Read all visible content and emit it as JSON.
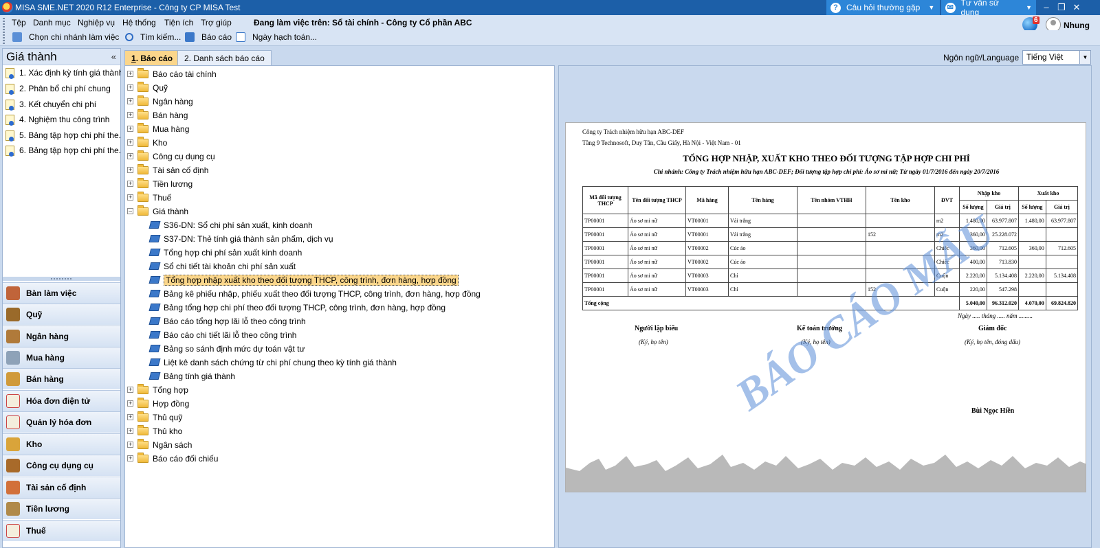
{
  "window": {
    "title": "MISA SME.NET 2020 R12 Enterprise - Công ty CP MISA Test",
    "faq": "Câu hỏi thường gặp",
    "support": "Tư vấn sử dụng"
  },
  "menu": {
    "items": [
      "Tệp",
      "Danh mục",
      "Nghiệp vụ",
      "Hệ thống",
      "Tiện ích",
      "Trợ giúp"
    ],
    "working_on": "Đang làm việc trên: Sổ tài chính - Công ty Cổ phần ABC",
    "notification_count": "6",
    "user": "Nhung"
  },
  "toolbar": {
    "branch": "Chọn chi nhánh làm việc",
    "search": "Tìm kiếm...",
    "report": "Báo cáo",
    "posting_date": "Ngày hạch toán..."
  },
  "left_panel": {
    "title": "Giá thành",
    "items": [
      "1. Xác định kỳ tính giá thành",
      "2. Phân bổ chi phí chung",
      "3. Kết chuyển chi phí",
      "4. Nghiệm thu công trình",
      "5. Bảng tập hợp chi phí the...",
      "6. Bảng tập hợp chi phí the..."
    ],
    "nav": [
      "Bàn làm việc",
      "Quỹ",
      "Ngân hàng",
      "Mua hàng",
      "Bán hàng",
      "Hóa đơn điện tử",
      "Quản lý hóa đơn",
      "Kho",
      "Công cụ dụng cụ",
      "Tài sản cố định",
      "Tiền lương",
      "Thuế"
    ]
  },
  "tabs": {
    "reports_num": "1",
    "reports_text": ". Báo cáo",
    "report_list": "2. Danh sách báo cáo"
  },
  "language": {
    "label": "Ngôn ngữ/Language",
    "value": "Tiếng Việt"
  },
  "tree": {
    "folders_before": [
      "Báo cáo tài chính",
      "Quỹ",
      "Ngân hàng",
      "Bán hàng",
      "Mua hàng",
      "Kho",
      "Công cụ dụng cụ",
      "Tài sản cố định",
      "Tiền lương",
      "Thuế"
    ],
    "expanded_folder": "Giá thành",
    "reports": [
      "S36-DN: Sổ chi phí sản xuất, kinh doanh",
      "S37-DN: Thẻ tính giá thành sản phẩm, dịch vụ",
      "Tổng hợp chi phí sản xuất kinh doanh",
      "Sổ chi tiết tài khoản chi phí sản xuất",
      "Tổng hợp nhập xuất kho theo đối tượng THCP, công trình, đơn hàng, hợp đồng",
      "Bảng kê phiếu nhập, phiếu xuất theo đối tượng THCP, công trình, đơn hàng, hợp đồng",
      "Bảng tổng hợp chi phí theo đối tượng THCP, công trình, đơn hàng, hợp đồng",
      "Báo cáo tổng hợp lãi lỗ theo công trình",
      "Báo cáo chi tiết lãi lỗ theo công trình",
      "Bảng so sánh định mức dự toán vật tư",
      "Liệt kê danh sách chứng từ chi phí chung theo kỳ tính giá thành",
      "Bảng tính giá thành"
    ],
    "selected_index": 4,
    "folders_after": [
      "Tổng hợp",
      "Hợp đồng",
      "Thủ quỹ",
      "Thủ kho",
      "Ngân sách",
      "Báo cáo đối chiếu"
    ]
  },
  "report_preview": {
    "company": "Công ty Trách nhiệm hữu hạn ABC-DEF",
    "address": "Tầng 9 Technosoft, Duy Tân, Cầu Giấy, Hà Nội - Việt Nam - 01",
    "title": "TỔNG HỢP NHẬP, XUẤT KHO THEO ĐỐI TƯỢNG TẬP HỢP CHI PHÍ",
    "subtitle": "Chi nhánh: Công ty Trách nhiệm hữu hạn ABC-DEF; Đối tượng tập hợp chi phí: Áo sơ mi nữ; Từ ngày 01/7/2016 đến ngày 20/7/2016",
    "headers": [
      "Mã đối tượng THCP",
      "Tên đối tượng THCP",
      "Mã hàng",
      "Tên hàng",
      "Tên nhóm VTHH",
      "Tên kho",
      "ĐVT",
      "Nhập kho",
      "Xuất kho"
    ],
    "subheaders": [
      "Số lượng",
      "Giá trị",
      "Số lượng",
      "Giá trị"
    ],
    "rows": [
      [
        "TP00001",
        "Áo sơ mi nữ",
        "VT00001",
        "Vải trắng",
        "",
        "",
        "m2",
        "1.480,00",
        "63.977.807",
        "1.480,00",
        "63.977.807"
      ],
      [
        "TP00001",
        "Áo sơ mi nữ",
        "VT00001",
        "Vải trắng",
        "",
        "152",
        "m2",
        "360,00",
        "25.228.072",
        "",
        ""
      ],
      [
        "TP00001",
        "Áo sơ mi nữ",
        "VT00002",
        "Cúc áo",
        "",
        "",
        "Chiếc",
        "360,00",
        "712.605",
        "360,00",
        "712.605"
      ],
      [
        "TP00001",
        "Áo sơ mi nữ",
        "VT00002",
        "Cúc áo",
        "",
        "",
        "Chiếc",
        "400,00",
        "713.830",
        "",
        ""
      ],
      [
        "TP00001",
        "Áo sơ mi nữ",
        "VT00003",
        "Chỉ",
        "",
        "",
        "Cuộn",
        "2.220,00",
        "5.134.408",
        "2.220,00",
        "5.134.408"
      ],
      [
        "TP00001",
        "Áo sơ mi nữ",
        "VT00003",
        "Chỉ",
        "",
        "152",
        "Cuộn",
        "220,00",
        "547.298",
        "",
        ""
      ]
    ],
    "total": [
      "Tổng cộng",
      "5.040,00",
      "96.312.020",
      "4.070,00",
      "69.824.820"
    ],
    "date_line": "Ngày ..... tháng ..... năm .........",
    "signers": [
      {
        "role": "Người lập biểu",
        "note": "(Ký, họ tên)"
      },
      {
        "role": "Kế toán trưởng",
        "note": "(Ký, họ tên)"
      },
      {
        "role": "Giám đốc",
        "note": "(Ký, họ tên, đóng dấu)"
      }
    ],
    "director_name": "Bùi Ngọc Hiền",
    "watermark": "BÁO CÁO MẪU"
  },
  "colors": {
    "titlebar": "#1c5fa8",
    "accent_tab": "#fbd68b",
    "watermark": "#5a8cd7"
  }
}
